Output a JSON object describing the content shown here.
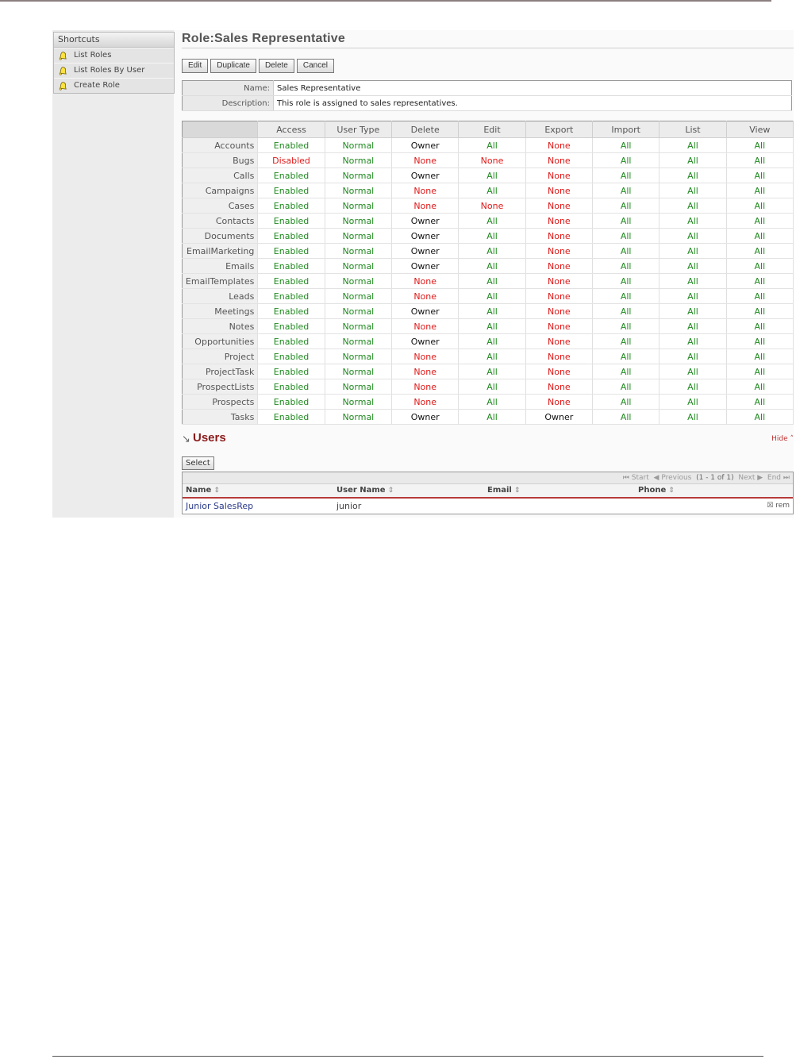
{
  "shortcuts": {
    "title": "Shortcuts",
    "items": [
      {
        "label": "List Roles",
        "icon": "bell-icon"
      },
      {
        "label": "List Roles By User",
        "icon": "bell-icon"
      },
      {
        "label": "Create Role",
        "icon": "bell-icon"
      }
    ]
  },
  "page": {
    "title": "Role:Sales Representative"
  },
  "buttons": {
    "edit": "Edit",
    "duplicate": "Duplicate",
    "delete": "Delete",
    "cancel": "Cancel"
  },
  "detail": {
    "name_label": "Name:",
    "name_value": "Sales Representative",
    "desc_label": "Description:",
    "desc_value": "This role is assigned to sales representatives."
  },
  "acl": {
    "columns": [
      "Access",
      "User Type",
      "Delete",
      "Edit",
      "Export",
      "Import",
      "List",
      "View"
    ],
    "rows": [
      {
        "module": "Accounts",
        "values": [
          "Enabled",
          "Normal",
          "Owner",
          "All",
          "None",
          "All",
          "All",
          "All"
        ]
      },
      {
        "module": "Bugs",
        "values": [
          "Disabled",
          "Normal",
          "None",
          "None",
          "None",
          "All",
          "All",
          "All"
        ]
      },
      {
        "module": "Calls",
        "values": [
          "Enabled",
          "Normal",
          "Owner",
          "All",
          "None",
          "All",
          "All",
          "All"
        ]
      },
      {
        "module": "Campaigns",
        "values": [
          "Enabled",
          "Normal",
          "None",
          "All",
          "None",
          "All",
          "All",
          "All"
        ]
      },
      {
        "module": "Cases",
        "values": [
          "Enabled",
          "Normal",
          "None",
          "None",
          "None",
          "All",
          "All",
          "All"
        ]
      },
      {
        "module": "Contacts",
        "values": [
          "Enabled",
          "Normal",
          "Owner",
          "All",
          "None",
          "All",
          "All",
          "All"
        ]
      },
      {
        "module": "Documents",
        "values": [
          "Enabled",
          "Normal",
          "Owner",
          "All",
          "None",
          "All",
          "All",
          "All"
        ]
      },
      {
        "module": "EmailMarketing",
        "values": [
          "Enabled",
          "Normal",
          "Owner",
          "All",
          "None",
          "All",
          "All",
          "All"
        ]
      },
      {
        "module": "Emails",
        "values": [
          "Enabled",
          "Normal",
          "Owner",
          "All",
          "None",
          "All",
          "All",
          "All"
        ]
      },
      {
        "module": "EmailTemplates",
        "values": [
          "Enabled",
          "Normal",
          "None",
          "All",
          "None",
          "All",
          "All",
          "All"
        ]
      },
      {
        "module": "Leads",
        "values": [
          "Enabled",
          "Normal",
          "None",
          "All",
          "None",
          "All",
          "All",
          "All"
        ]
      },
      {
        "module": "Meetings",
        "values": [
          "Enabled",
          "Normal",
          "Owner",
          "All",
          "None",
          "All",
          "All",
          "All"
        ]
      },
      {
        "module": "Notes",
        "values": [
          "Enabled",
          "Normal",
          "None",
          "All",
          "None",
          "All",
          "All",
          "All"
        ]
      },
      {
        "module": "Opportunities",
        "values": [
          "Enabled",
          "Normal",
          "Owner",
          "All",
          "None",
          "All",
          "All",
          "All"
        ]
      },
      {
        "module": "Project",
        "values": [
          "Enabled",
          "Normal",
          "None",
          "All",
          "None",
          "All",
          "All",
          "All"
        ]
      },
      {
        "module": "ProjectTask",
        "values": [
          "Enabled",
          "Normal",
          "None",
          "All",
          "None",
          "All",
          "All",
          "All"
        ]
      },
      {
        "module": "ProspectLists",
        "values": [
          "Enabled",
          "Normal",
          "None",
          "All",
          "None",
          "All",
          "All",
          "All"
        ]
      },
      {
        "module": "Prospects",
        "values": [
          "Enabled",
          "Normal",
          "None",
          "All",
          "None",
          "All",
          "All",
          "All"
        ]
      },
      {
        "module": "Tasks",
        "values": [
          "Enabled",
          "Normal",
          "Owner",
          "All",
          "Owner",
          "All",
          "All",
          "All"
        ]
      }
    ],
    "colors": {
      "positive": "#1f8a1f",
      "negative": "#e01818",
      "owner": "#111111"
    }
  },
  "users": {
    "title": "Users",
    "hide_label": "Hide",
    "select_label": "Select",
    "pager": {
      "start": "Start",
      "previous": "Previous",
      "range": "(1 - 1 of 1)",
      "next": "Next",
      "end": "End"
    },
    "columns": [
      "Name",
      "User Name",
      "Email",
      "Phone"
    ],
    "rows": [
      {
        "name": "Junior SalesRep",
        "user_name": "junior",
        "email": "",
        "phone": "",
        "action": "rem"
      }
    ]
  }
}
